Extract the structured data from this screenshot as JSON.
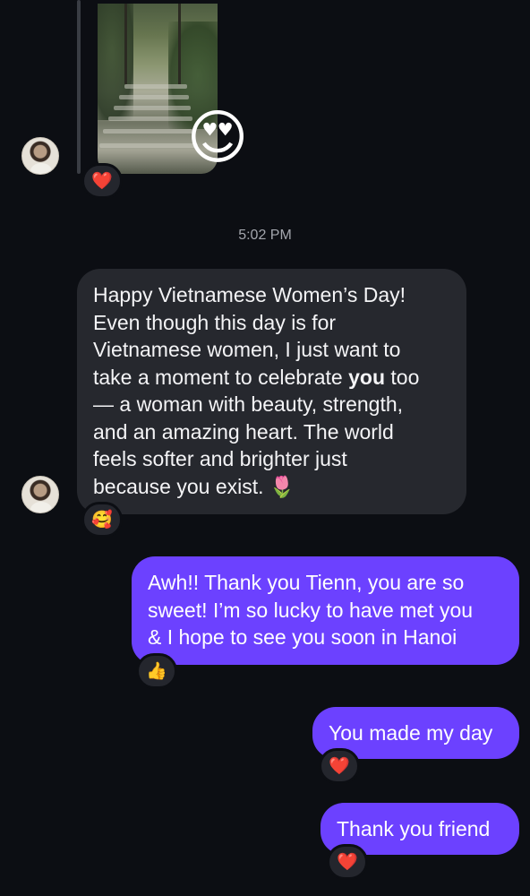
{
  "thread": {
    "photo_reaction": "😍",
    "photo_like": "❤️",
    "timestamp": "5:02 PM",
    "incoming": {
      "line1": "Happy Vietnamese Women’s Day!",
      "line2": "Even though this day is for",
      "line3": "Vietnamese women, I just want to",
      "line4_pre": "take a moment to celebrate ",
      "line4_bold": "you",
      "line4_post": " too",
      "line5": "— a woman with beauty, strength,",
      "line6": "and an amazing heart. The world",
      "line7": "feels softer and brighter just",
      "line8": "because you exist. 🌷",
      "reaction": "🥰"
    },
    "outgoing": [
      {
        "lines": [
          "Awh!! Thank you Tienn, you are so",
          "sweet! I’m so lucky to have met you",
          "& I hope to see you soon in Hanoi"
        ],
        "reaction": "👍"
      },
      {
        "lines": [
          "You made my day"
        ],
        "reaction": "❤️"
      },
      {
        "lines": [
          "Thank you friend"
        ],
        "reaction": "❤️"
      }
    ]
  },
  "colors": {
    "background": "#0c0e13",
    "incoming_bubble": "#26282e",
    "outgoing_bubble": "#6c41ff",
    "timestamp": "#a3a6ad"
  }
}
